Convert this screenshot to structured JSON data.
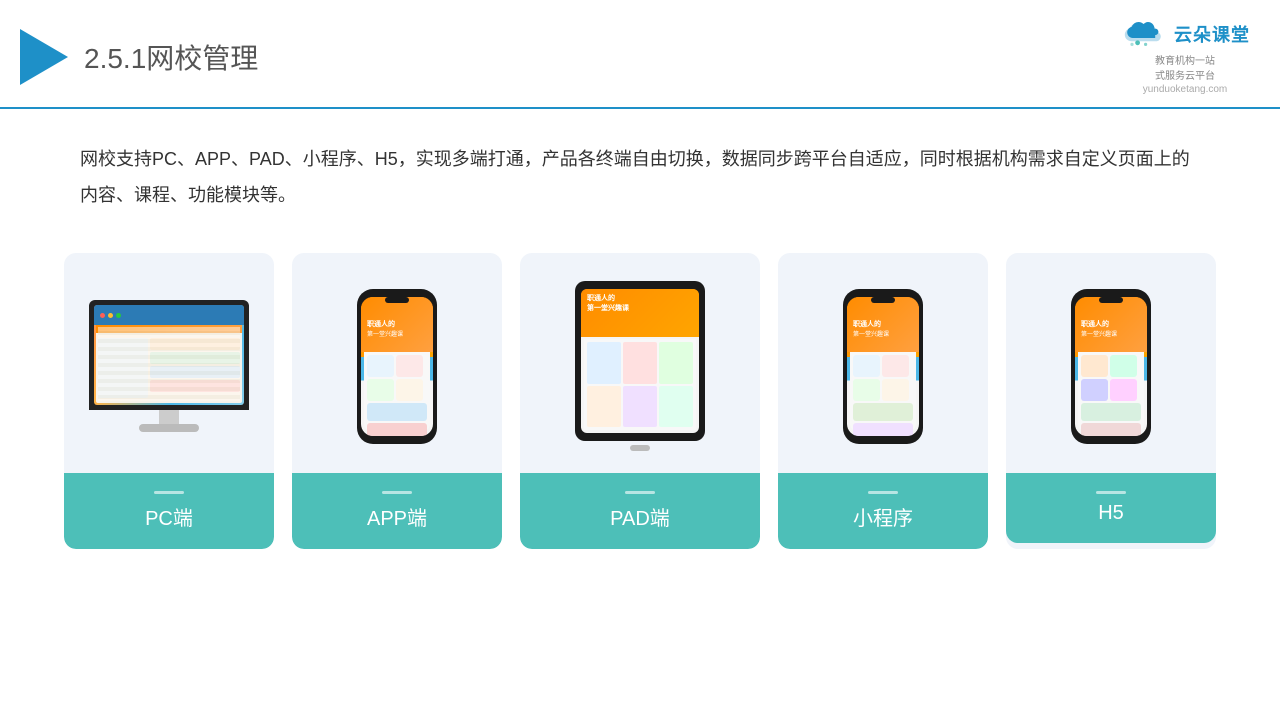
{
  "header": {
    "title_prefix": "2.5.1",
    "title_main": "网校管理",
    "logo_name": "云朵课堂",
    "logo_url": "yunduoketang.com",
    "logo_sub1": "教育机构一站",
    "logo_sub2": "式服务云平台"
  },
  "description": {
    "text": "网校支持PC、APP、PAD、小程序、H5，实现多端打通，产品各终端自由切换，数据同步跨平台自适应，同时根据机构需求自定义页面上的内容、课程、功能模块等。"
  },
  "cards": [
    {
      "id": "pc",
      "label": "PC端"
    },
    {
      "id": "app",
      "label": "APP端"
    },
    {
      "id": "pad",
      "label": "PAD端"
    },
    {
      "id": "miniprogram",
      "label": "小程序"
    },
    {
      "id": "h5",
      "label": "H5"
    }
  ],
  "colors": {
    "primary": "#1e90c8",
    "accent": "#4dbfb8",
    "card_bg": "#eef2f8"
  }
}
